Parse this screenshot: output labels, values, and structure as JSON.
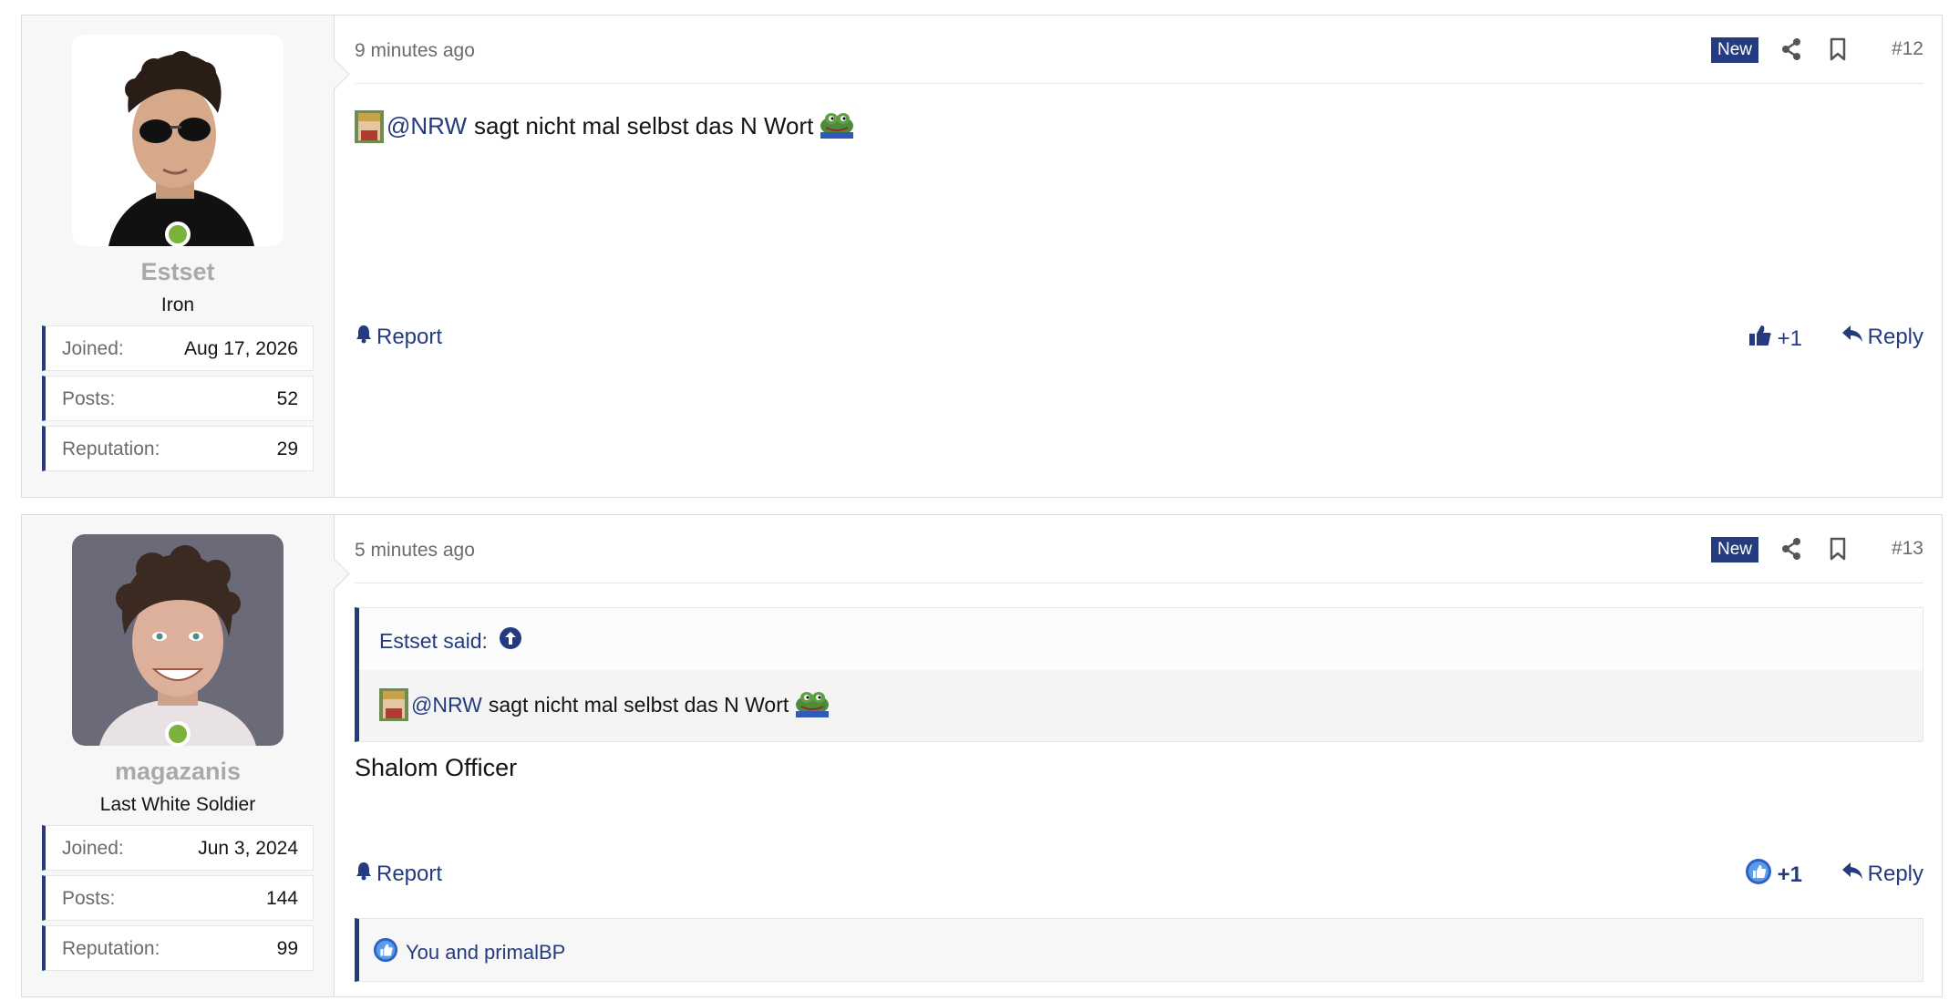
{
  "colors": {
    "accent": "#243b80",
    "online": "#7bb23b",
    "username": "#a9a9a9"
  },
  "posts": [
    {
      "time": "9 minutes ago",
      "badge": "New",
      "number": "#12",
      "user": {
        "name": "Estset",
        "title": "Iron",
        "stats": [
          {
            "label": "Joined:",
            "value": "Aug 17, 2026"
          },
          {
            "label": "Posts:",
            "value": "52"
          },
          {
            "label": "Reputation:",
            "value": "29"
          }
        ]
      },
      "body": {
        "mention": "@NRW",
        "text": "sagt nicht mal selbst das N Wort"
      },
      "report": "Report",
      "like": "+1",
      "reply": "Reply"
    },
    {
      "time": "5 minutes ago",
      "badge": "New",
      "number": "#13",
      "user": {
        "name": "magazanis",
        "title": "Last White Soldier",
        "stats": [
          {
            "label": "Joined:",
            "value": "Jun 3, 2024"
          },
          {
            "label": "Posts:",
            "value": "144"
          },
          {
            "label": "Reputation:",
            "value": "99"
          }
        ]
      },
      "quote": {
        "author": "Estset said:",
        "mention": "@NRW",
        "text": "sagt nicht mal selbst das N Wort"
      },
      "body": {
        "text": "Shalom Officer"
      },
      "report": "Report",
      "like": "+1",
      "reply": "Reply",
      "likes": "You and primalBP"
    }
  ]
}
